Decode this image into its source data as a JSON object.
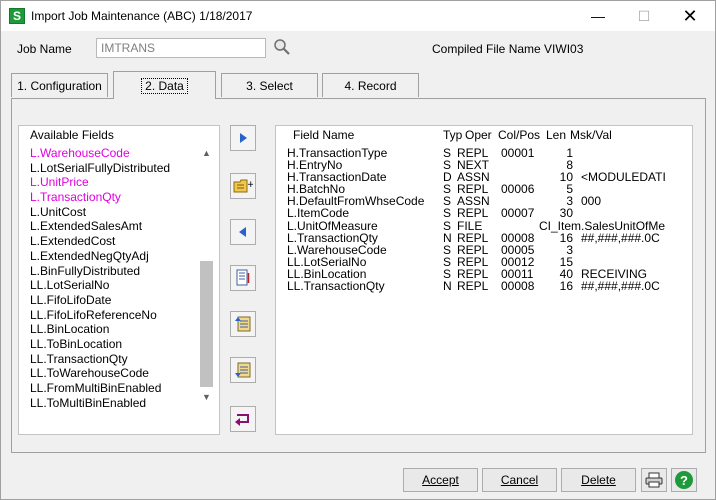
{
  "window": {
    "app_icon_letter": "S",
    "title": "Import Job Maintenance (ABC) 1/18/2017",
    "minimize_glyph": "—",
    "maximize_glyph": "☐",
    "close_glyph": "✕"
  },
  "header": {
    "job_name_label": "Job Name",
    "job_name_value": "IMTRANS",
    "compiled_label": "Compiled File Name VIWI03"
  },
  "tabs": [
    {
      "label": "1. Configuration"
    },
    {
      "label": "2. Data"
    },
    {
      "label": "3. Select"
    },
    {
      "label": "4. Record"
    }
  ],
  "available_fields": {
    "header": "Available Fields",
    "items": [
      {
        "label": "L.WarehouseCode",
        "highlight": true
      },
      {
        "label": "L.LotSerialFullyDistributed",
        "highlight": false
      },
      {
        "label": "L.UnitPrice",
        "highlight": true
      },
      {
        "label": "L.TransactionQty",
        "highlight": true
      },
      {
        "label": "L.UnitCost",
        "highlight": false
      },
      {
        "label": "L.ExtendedSalesAmt",
        "highlight": false
      },
      {
        "label": "L.ExtendedCost",
        "highlight": false
      },
      {
        "label": "L.ExtendedNegQtyAdj",
        "highlight": false
      },
      {
        "label": "L.BinFullyDistributed",
        "highlight": false
      },
      {
        "label": "LL.LotSerialNo",
        "highlight": false
      },
      {
        "label": "LL.FifoLifoDate",
        "highlight": false
      },
      {
        "label": "LL.FifoLifoReferenceNo",
        "highlight": false
      },
      {
        "label": "LL.BinLocation",
        "highlight": false
      },
      {
        "label": "LL.ToBinLocation",
        "highlight": false
      },
      {
        "label": "LL.TransactionQty",
        "highlight": false
      },
      {
        "label": "LL.ToWarehouseCode",
        "highlight": false
      },
      {
        "label": "LL.FromMultiBinEnabled",
        "highlight": false
      },
      {
        "label": "LL.ToMultiBinEnabled",
        "highlight": false
      }
    ]
  },
  "grid": {
    "headers": {
      "name": "Field Name",
      "typ": "Typ",
      "oper": "Oper",
      "col": "Col/Pos",
      "len": "Len",
      "msk": "Msk/Val"
    },
    "rows": [
      {
        "name": "H.TransactionType",
        "typ": "S",
        "oper": "REPL",
        "col": "00001",
        "len": "1",
        "msk": ""
      },
      {
        "name": "H.EntryNo",
        "typ": "S",
        "oper": "NEXT",
        "col": "",
        "len": "8",
        "msk": ""
      },
      {
        "name": "H.TransactionDate",
        "typ": "D",
        "oper": "ASSN",
        "col": "",
        "len": "10",
        "msk": "<MODULEDATI"
      },
      {
        "name": "H.BatchNo",
        "typ": "S",
        "oper": "REPL",
        "col": "00006",
        "len": "5",
        "msk": ""
      },
      {
        "name": "H.DefaultFromWhseCode",
        "typ": "S",
        "oper": "ASSN",
        "col": "",
        "len": "3",
        "msk": "000"
      },
      {
        "name": "L.ItemCode",
        "typ": "S",
        "oper": "REPL",
        "col": "00007",
        "len": "30",
        "msk": ""
      },
      {
        "name": "L.UnitOfMeasure",
        "typ": "S",
        "oper": "FILE",
        "col": "",
        "len": "CI_Item.SalesUnitOfMe",
        "msk": ""
      },
      {
        "name": "L.TransactionQty",
        "typ": "N",
        "oper": "REPL",
        "col": "00008",
        "len": "16",
        "msk": "##,###,###.0C"
      },
      {
        "name": "L.WarehouseCode",
        "typ": "S",
        "oper": "REPL",
        "col": "00005",
        "len": "3",
        "msk": ""
      },
      {
        "name": "LL.LotSerialNo",
        "typ": "S",
        "oper": "REPL",
        "col": "00012",
        "len": "15",
        "msk": ""
      },
      {
        "name": "LL.BinLocation",
        "typ": "S",
        "oper": "REPL",
        "col": "00011",
        "len": "40",
        "msk": "RECEIVING"
      },
      {
        "name": "LL.TransactionQty",
        "typ": "N",
        "oper": "REPL",
        "col": "00008",
        "len": "16",
        "msk": "##,###,###.0C"
      }
    ]
  },
  "buttons": {
    "accept": "Accept",
    "cancel": "Cancel",
    "delete": "Delete",
    "help": "?"
  },
  "colors": {
    "highlight_text": "#e000e0",
    "app_green": "#1f9a3a",
    "mid_button_arrow": "#2a62c9"
  }
}
